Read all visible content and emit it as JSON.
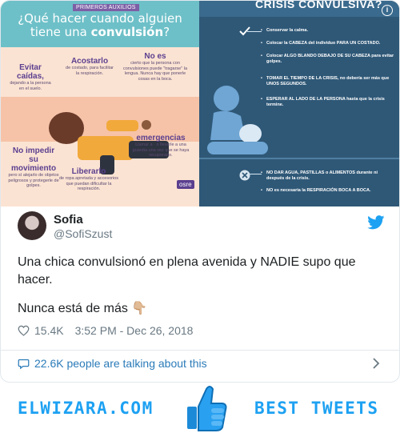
{
  "media_left": {
    "tag": "PRIMEROS AUXILIOS",
    "title_line1": "¿Qué hacer cuando alguien",
    "title_line2_pre": "tiene una ",
    "title_line2_bold": "convulsión",
    "title_line2_post": "?",
    "labels": [
      {
        "h": "Evitar caídas,",
        "s": "dejando a la persona en el suelo."
      },
      {
        "h": "Acostarlo",
        "s": "de costado, para facilitar la respiración."
      },
      {
        "h": "No es",
        "s": "cierto que la persona con convulsiones puede \"tragarse\" la lengua. Nunca hay que ponerle cosas en la boca."
      },
      {
        "h": "No impedir su movimiento",
        "s": "pero sí alejarlo de objetos peligrosos y protegerle de golpes."
      },
      {
        "h": "Liberarlo",
        "s": "de ropa apretada y accesorios que puedan dificultar la respiración."
      },
      {
        "h": "emergencias",
        "s": "Llamar a · o llevarle a una guardia una vez que se haya recuperado."
      }
    ],
    "logo": "osre"
  },
  "media_right": {
    "title": "CRISIS CONVULSIVA?",
    "items": [
      "Conservar la calma.",
      "Colocar la CABEZA del individuo PARA UN COSTADO.",
      "Colocar ALGO BLANDO DEBAJO DE SU CABEZA para evitar golpes.",
      "TOMAR EL TIEMPO DE LA CRISIS, no debería ser más que UNOS SEGUNDOS.",
      "ESPERAR AL LADO DE LA PERSONA hasta que la crisis termine.",
      "NO DAR AGUA, PASTILLAS o ALIMENTOS durante ni después de la crisis.",
      "NO es necesaria la RESPIRACIÓN BOCA A BOCA."
    ]
  },
  "tweet": {
    "name": "Sofia",
    "handle": "@SofiSzust",
    "text_line1": "Una chica convulsionó en plena avenida y NADIE supo que hacer.",
    "text_line2": "Nunca está de más 👇🏼",
    "likes": "15.4K",
    "timestamp": "3:52 PM - Dec 26, 2018",
    "talking": "22.6K people are talking about this"
  },
  "footer": {
    "left": "ELWIZARA.COM",
    "right": "BEST TWEETS"
  },
  "colors": {
    "twitter_blue": "#1da1f2",
    "link_blue": "#2b7bb9",
    "muted": "#697882"
  }
}
